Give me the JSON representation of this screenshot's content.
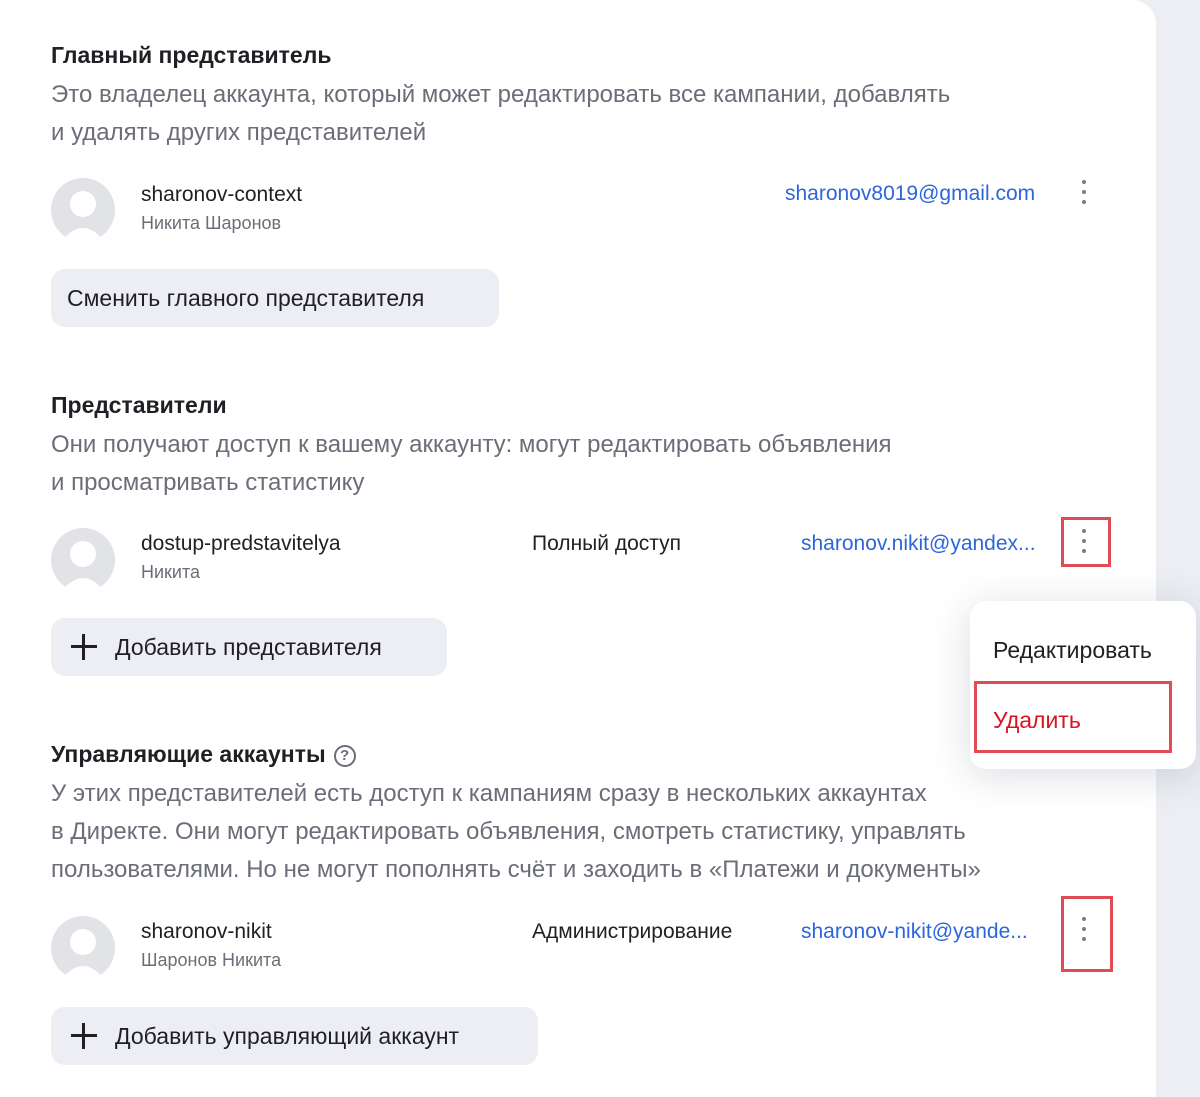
{
  "main_rep": {
    "title": "Главный представитель",
    "desc_line1": "Это владелец аккаунта, который может редактировать все кампании, добавлять",
    "desc_line2": "и удалять других представителей",
    "user": {
      "login": "sharonov-context",
      "name": "Никита Шаронов",
      "email": "sharonov8019@gmail.com",
      "avatar_icon": "user-avatar-icon",
      "menu_icon": "more-vertical-icon"
    },
    "change_button": "Сменить главного представителя"
  },
  "reps": {
    "title": "Представители",
    "desc_line1": "Они получают доступ к вашему аккаунту: могут редактировать объявления",
    "desc_line2": "и просматривать статистику",
    "user": {
      "login": "dostup-predstavitelya",
      "name": "Никита",
      "access": "Полный доступ",
      "email": "sharonov.nikit@yandex...",
      "avatar_icon": "user-avatar-icon",
      "menu_icon": "more-vertical-icon"
    },
    "add_button": "Добавить представителя"
  },
  "managers": {
    "title": "Управляющие аккаунты",
    "help_icon": "?",
    "desc_line1": "У этих представителей есть доступ к кампаниям сразу в нескольких аккаунтах",
    "desc_line2": "в Директе. Они могут редактировать объявления, смотреть статистику, управлять",
    "desc_line3": "пользователями. Но не могут пополнять счёт и заходить в «Платежи и документы»",
    "user": {
      "login": "sharonov-nikit",
      "name": "Шаронов Никита",
      "access": "Администрирование",
      "email": "sharonov-nikit@yande...",
      "avatar_icon": "user-avatar-icon",
      "menu_icon": "more-vertical-icon"
    },
    "add_button": "Добавить управляющий аккаунт"
  },
  "context_menu": {
    "edit": "Редактировать",
    "delete": "Удалить"
  },
  "colors": {
    "link": "#2c66db",
    "delete": "#d8141e",
    "highlight": "#e04c55",
    "button_bg": "#eceef3"
  }
}
